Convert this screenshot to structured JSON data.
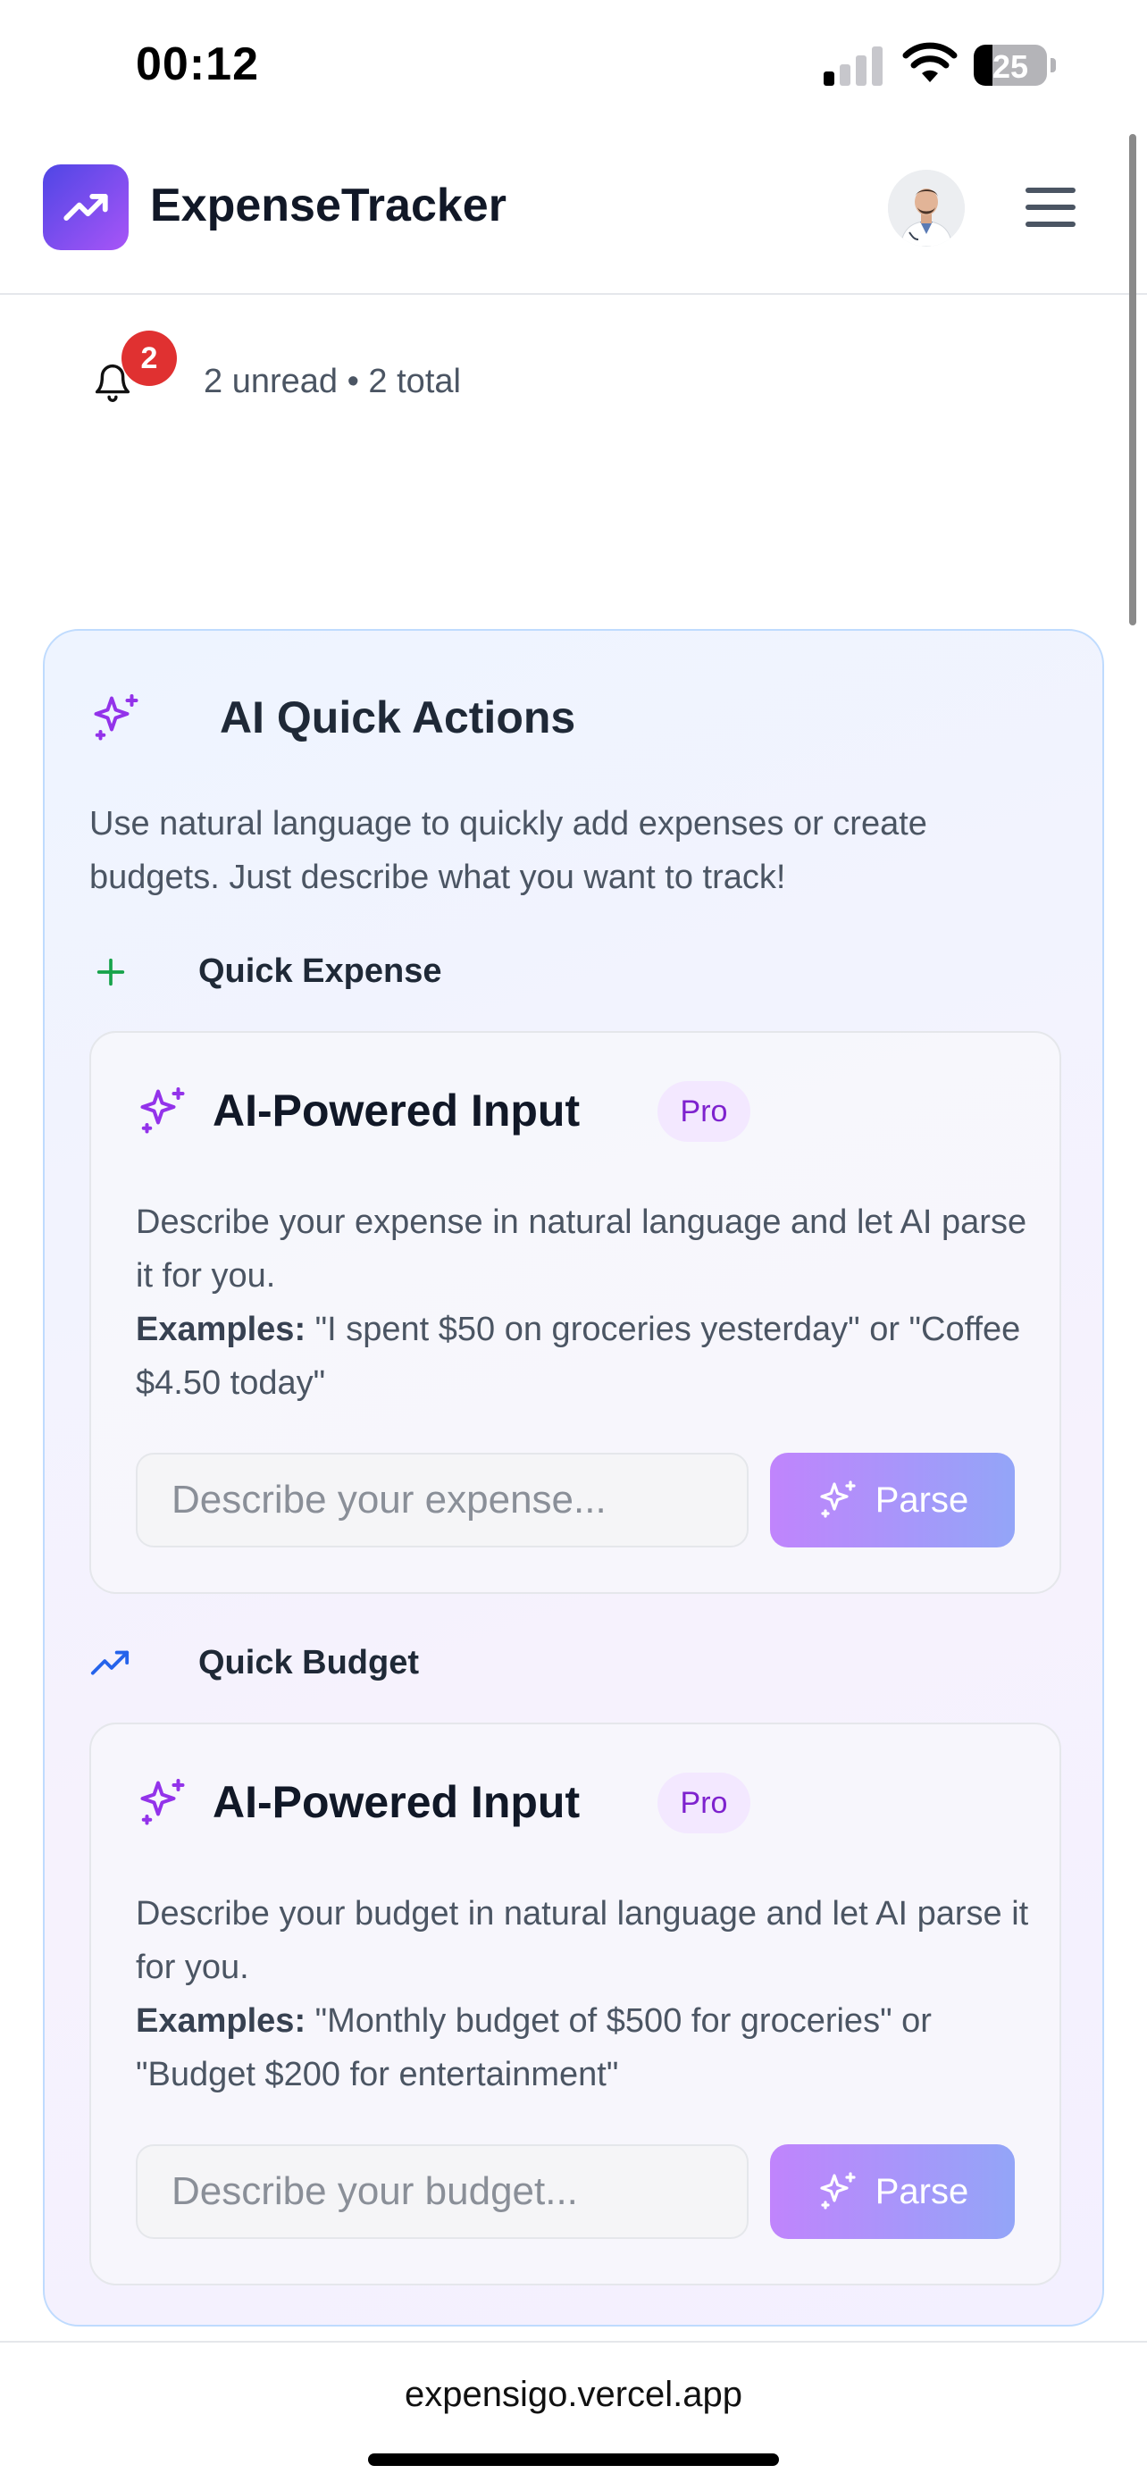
{
  "status_bar": {
    "time": "00:12",
    "battery_level": "25"
  },
  "header": {
    "app_name": "ExpenseTracker",
    "logo_icon": "trending-up-icon",
    "avatar_alt": "user avatar",
    "menu_icon": "hamburger-menu-icon"
  },
  "notifications": {
    "badge_count": "2",
    "summary": "2 unread • 2 total"
  },
  "ai_quick_actions": {
    "title": "AI Quick Actions",
    "description": "Use natural language to quickly add expenses or create budgets. Just describe what you want to track!",
    "sections": [
      {
        "label": "Quick Expense",
        "icon": "plus-icon",
        "card": {
          "title": "AI-Powered Input",
          "badge": "Pro",
          "description": "Describe your expense in natural language and let AI parse it for you.",
          "examples_label": "Examples:",
          "examples_text": " \"I spent $50 on groceries yesterday\" or \"Coffee $4.50 today\"",
          "input_placeholder": "Describe your expense...",
          "button_label": "Parse"
        }
      },
      {
        "label": "Quick Budget",
        "icon": "trending-up-icon",
        "card": {
          "title": "AI-Powered Input",
          "badge": "Pro",
          "description": "Describe your budget in natural language and let AI parse it for you.",
          "examples_label": "Examples:",
          "examples_text": " \"Monthly budget of $500 for groceries\" or \"Budget $200 for entertainment\"",
          "input_placeholder": "Describe your budget...",
          "button_label": "Parse"
        }
      }
    ]
  },
  "browser": {
    "url": "expensigo.vercel.app"
  },
  "colors": {
    "brand_gradient_start": "#4f46e5",
    "brand_gradient_end": "#a855f7",
    "sparkle_purple": "#9333ea",
    "badge_red": "#e03131",
    "plus_green": "#16a34a",
    "trend_blue": "#2563eb"
  }
}
